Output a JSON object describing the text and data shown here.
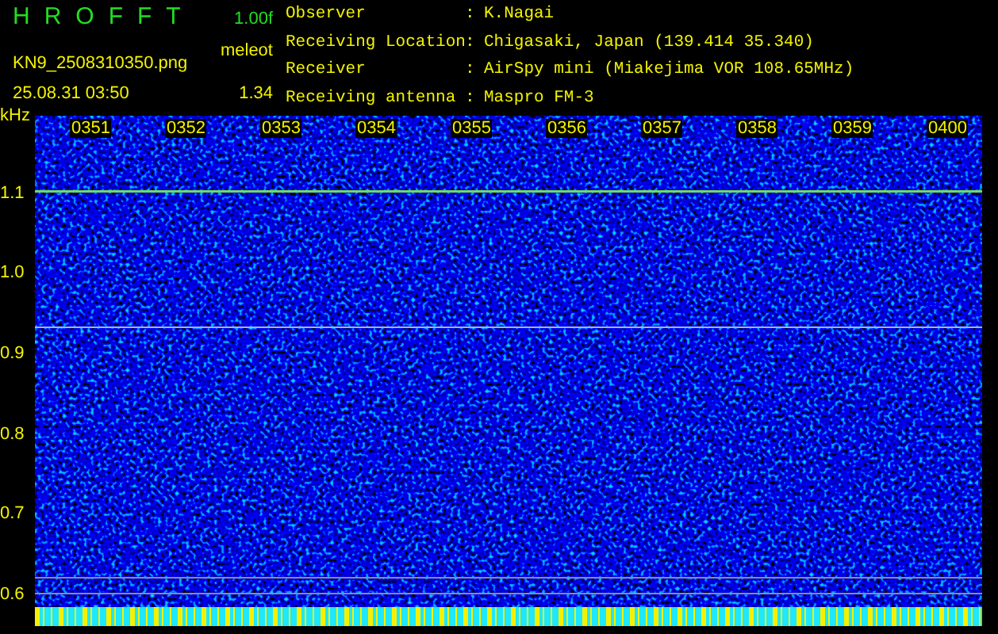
{
  "header": {
    "logo": "HROFFT",
    "version": "1.00f",
    "filename": "KN9_2508310350.png",
    "mode": "meleot",
    "datetime": "25.08.31 03:50",
    "value": "1.34"
  },
  "info": [
    {
      "label": "Observer",
      "separator": ":",
      "value": "K.Nagai"
    },
    {
      "label": "Receiving Location",
      "separator": ":",
      "value": "Chigasaki, Japan (139.414 35.340)"
    },
    {
      "label": "Receiver",
      "separator": ":",
      "value": "AirSpy mini (Miakejima VOR 108.65MHz)"
    },
    {
      "label": "Receiving antenna",
      "separator": ":",
      "value": "Maspro FM-3"
    }
  ],
  "unit": "kHz",
  "time_labels": [
    "0351",
    "0352",
    "0353",
    "0354",
    "0355",
    "0356",
    "0357",
    "0358",
    "0359",
    "0400"
  ],
  "y_labels": [
    "1.1",
    "1.0",
    "0.9",
    "0.8",
    "0.7",
    "0.6"
  ]
}
